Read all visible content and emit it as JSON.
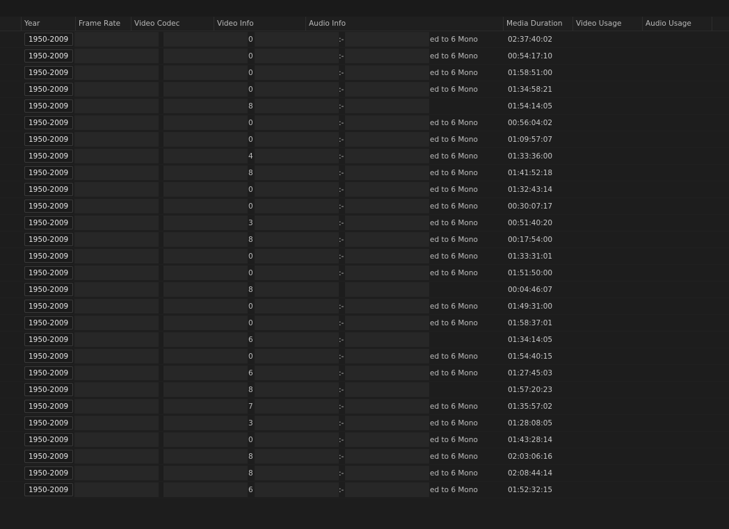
{
  "columns": {
    "year": "Year",
    "frame_rate": "Frame Rate",
    "video_codec": "Video Codec",
    "video_info": "Video Info",
    "audio_info": "Audio Info",
    "media_duration": "Media Duration",
    "video_usage": "Video Usage",
    "audio_usage": "Audio Usage"
  },
  "rows": [
    {
      "year": "1950-2009",
      "video_frag": "0",
      "audio_frag": ":-",
      "audio_text": "ed to 6 Mono",
      "duration": "02:37:40:02"
    },
    {
      "year": "1950-2009",
      "video_frag": "0",
      "audio_frag": ":-",
      "audio_text": "ed to 6 Mono",
      "duration": "00:54:17:10"
    },
    {
      "year": "1950-2009",
      "video_frag": "0",
      "audio_frag": ":-",
      "audio_text": "ed to 6 Mono",
      "duration": "01:58:51:00"
    },
    {
      "year": "1950-2009",
      "video_frag": "0",
      "audio_frag": ":-",
      "audio_text": "ed to 6 Mono",
      "duration": "01:34:58:21"
    },
    {
      "year": "1950-2009",
      "video_frag": "8",
      "audio_frag": ":-",
      "audio_text": "",
      "duration": "01:54:14:05"
    },
    {
      "year": "1950-2009",
      "video_frag": "0",
      "audio_frag": ":-",
      "audio_text": "ed to 6 Mono",
      "duration": "00:56:04:02"
    },
    {
      "year": "1950-2009",
      "video_frag": "0",
      "audio_frag": ":-",
      "audio_text": "ed to 6 Mono",
      "duration": "01:09:57:07"
    },
    {
      "year": "1950-2009",
      "video_frag": "4",
      "audio_frag": ":-",
      "audio_text": "ed to 6 Mono",
      "duration": "01:33:36:00"
    },
    {
      "year": "1950-2009",
      "video_frag": "8",
      "audio_frag": ":-",
      "audio_text": "ed to 6 Mono",
      "duration": "01:41:52:18"
    },
    {
      "year": "1950-2009",
      "video_frag": "0",
      "audio_frag": ":-",
      "audio_text": "ed to 6 Mono",
      "duration": "01:32:43:14"
    },
    {
      "year": "1950-2009",
      "video_frag": "0",
      "audio_frag": ":-",
      "audio_text": "ed to 6 Mono",
      "duration": "00:30:07:17"
    },
    {
      "year": "1950-2009",
      "video_frag": "3",
      "audio_frag": ":-",
      "audio_text": "ed to 6 Mono",
      "duration": "00:51:40:20"
    },
    {
      "year": "1950-2009",
      "video_frag": "8",
      "audio_frag": ":-",
      "audio_text": "ed to 6 Mono",
      "duration": "00:17:54:00"
    },
    {
      "year": "1950-2009",
      "video_frag": "0",
      "audio_frag": ":-",
      "audio_text": "ed to 6 Mono",
      "duration": "01:33:31:01"
    },
    {
      "year": "1950-2009",
      "video_frag": "0",
      "audio_frag": ":-",
      "audio_text": "ed to 6 Mono",
      "duration": "01:51:50:00"
    },
    {
      "year": "1950-2009",
      "video_frag": "8",
      "audio_frag": "",
      "audio_text": "",
      "duration": "00:04:46:07"
    },
    {
      "year": "1950-2009",
      "video_frag": "0",
      "audio_frag": ":-",
      "audio_text": "ed to 6 Mono",
      "duration": "01:49:31:00"
    },
    {
      "year": "1950-2009",
      "video_frag": "0",
      "audio_frag": ":-",
      "audio_text": "ed to 6 Mono",
      "duration": "01:58:37:01"
    },
    {
      "year": "1950-2009",
      "video_frag": "6",
      "audio_frag": ":-",
      "audio_text": "",
      "duration": "01:34:14:05"
    },
    {
      "year": "1950-2009",
      "video_frag": "0",
      "audio_frag": ":-",
      "audio_text": "ed to 6 Mono",
      "duration": "01:54:40:15"
    },
    {
      "year": "1950-2009",
      "video_frag": "6",
      "audio_frag": ":-",
      "audio_text": "ed to 6 Mono",
      "duration": "01:27:45:03"
    },
    {
      "year": "1950-2009",
      "video_frag": "8",
      "audio_frag": ":-",
      "audio_text": "",
      "duration": "01:57:20:23"
    },
    {
      "year": "1950-2009",
      "video_frag": "7",
      "audio_frag": ":-",
      "audio_text": "ed to 6 Mono",
      "duration": "01:35:57:02"
    },
    {
      "year": "1950-2009",
      "video_frag": "3",
      "audio_frag": ":-",
      "audio_text": "ed to 6 Mono",
      "duration": "01:28:08:05"
    },
    {
      "year": "1950-2009",
      "video_frag": "0",
      "audio_frag": ":-",
      "audio_text": "ed to 6 Mono",
      "duration": "01:43:28:14"
    },
    {
      "year": "1950-2009",
      "video_frag": "8",
      "audio_frag": ":-",
      "audio_text": "ed to 6 Mono",
      "duration": "02:03:06:16"
    },
    {
      "year": "1950-2009",
      "video_frag": "8",
      "audio_frag": ":-",
      "audio_text": "ed to 6 Mono",
      "duration": "02:08:44:14"
    },
    {
      "year": "1950-2009",
      "video_frag": "6",
      "audio_frag": ":-",
      "audio_text": "ed to 6 Mono",
      "duration": "01:52:32:15"
    }
  ]
}
